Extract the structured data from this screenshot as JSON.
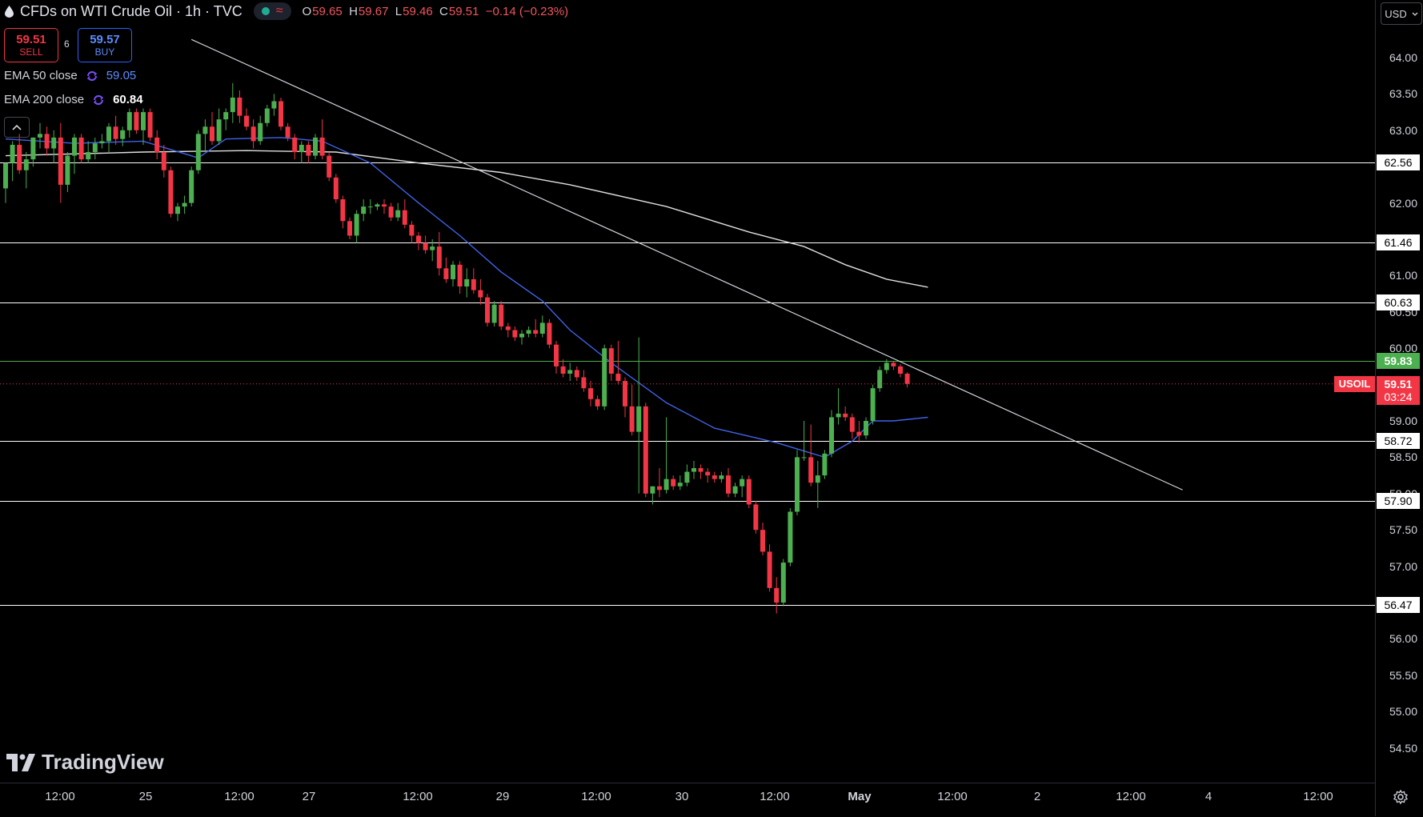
{
  "header": {
    "title": "CFDs on WTI Crude Oil · 1h · TVC",
    "ohlc": {
      "o_label": "O",
      "o": "59.65",
      "h_label": "H",
      "h": "59.67",
      "l_label": "L",
      "l": "59.46",
      "c_label": "C",
      "c": "59.51",
      "change": "−0.14 (−0.23%)"
    }
  },
  "trade": {
    "sell_price": "59.51",
    "sell_label": "SELL",
    "spread": "6",
    "buy_price": "59.57",
    "buy_label": "BUY"
  },
  "indicators": [
    {
      "label": "EMA 50 close",
      "value": "59.05",
      "color": "#5b8cff"
    },
    {
      "label": "EMA 200 close",
      "value": "60.84",
      "color": "#ffffff"
    }
  ],
  "price_axis": {
    "currency": "USD",
    "ticks": [
      "64.00",
      "63.50",
      "63.00",
      "62.00",
      "61.00",
      "60.50",
      "60.00",
      "59.00",
      "58.50",
      "58.00",
      "57.50",
      "57.00",
      "56.00",
      "55.50",
      "55.00",
      "54.50"
    ],
    "tick_values": [
      64.0,
      63.5,
      63.0,
      62.0,
      61.0,
      60.5,
      60.0,
      59.0,
      58.5,
      58.0,
      57.5,
      57.0,
      56.0,
      55.5,
      55.0,
      54.5
    ]
  },
  "levels": [
    {
      "value": 62.56,
      "label": "62.56",
      "color": "#ffffff"
    },
    {
      "value": 61.46,
      "label": "61.46",
      "color": "#ffffff"
    },
    {
      "value": 60.63,
      "label": "60.63",
      "color": "#ffffff"
    },
    {
      "value": 59.83,
      "label": "59.83",
      "color": "#4caf50"
    },
    {
      "value": 58.72,
      "label": "58.72",
      "color": "#ffffff"
    },
    {
      "value": 57.9,
      "label": "57.90",
      "color": "#ffffff"
    },
    {
      "value": 56.47,
      "label": "56.47",
      "color": "#ffffff"
    }
  ],
  "current": {
    "symbol": "USOIL",
    "price": "59.51",
    "countdown": "03:24",
    "value": 59.51
  },
  "time_axis": {
    "labels": [
      {
        "text": "12:00",
        "bold": false
      },
      {
        "text": "25",
        "bold": false
      },
      {
        "text": "12:00",
        "bold": false
      },
      {
        "text": "27",
        "bold": false
      },
      {
        "text": "12:00",
        "bold": false
      },
      {
        "text": "29",
        "bold": false
      },
      {
        "text": "12:00",
        "bold": false
      },
      {
        "text": "30",
        "bold": false
      },
      {
        "text": "12:00",
        "bold": false
      },
      {
        "text": "May",
        "bold": true
      },
      {
        "text": "12:00",
        "bold": false
      },
      {
        "text": "2",
        "bold": false
      },
      {
        "text": "12:00",
        "bold": false
      },
      {
        "text": "4",
        "bold": false
      },
      {
        "text": "12:00",
        "bold": false
      }
    ]
  },
  "branding": {
    "logo_text": "TradingView"
  },
  "colors": {
    "up": "#4caf50",
    "down": "#f23645",
    "ema50": "#3f63e8",
    "ema200": "#e0e0e0",
    "trend": "#d1d4dc"
  },
  "chart_data": {
    "type": "candlestick",
    "title": "CFDs on WTI Crude Oil · 1h · TVC",
    "ylim": [
      54.25,
      64.6
    ],
    "candles": [
      [
        62.2,
        62.55,
        62.0,
        62.55
      ],
      [
        62.55,
        62.85,
        62.3,
        62.8
      ],
      [
        62.8,
        62.95,
        62.4,
        62.45
      ],
      [
        62.45,
        62.7,
        62.2,
        62.6
      ],
      [
        62.6,
        62.9,
        62.5,
        62.9
      ],
      [
        62.9,
        63.1,
        62.75,
        62.95
      ],
      [
        62.95,
        63.05,
        62.65,
        62.75
      ],
      [
        62.75,
        63.0,
        62.55,
        62.9
      ],
      [
        62.9,
        63.1,
        62.0,
        62.25
      ],
      [
        62.25,
        62.7,
        62.15,
        62.65
      ],
      [
        62.65,
        62.95,
        62.4,
        62.9
      ],
      [
        62.9,
        62.95,
        62.55,
        62.6
      ],
      [
        62.6,
        62.85,
        62.55,
        62.7
      ],
      [
        62.7,
        62.9,
        62.6,
        62.82
      ],
      [
        62.82,
        62.95,
        62.75,
        62.85
      ],
      [
        62.85,
        63.1,
        62.7,
        63.05
      ],
      [
        63.05,
        63.2,
        62.8,
        62.88
      ],
      [
        62.88,
        63.05,
        62.78,
        63.0
      ],
      [
        63.0,
        63.3,
        62.9,
        63.25
      ],
      [
        63.25,
        63.3,
        62.95,
        63.0
      ],
      [
        63.0,
        63.3,
        62.8,
        63.25
      ],
      [
        63.25,
        63.3,
        62.85,
        62.9
      ],
      [
        62.9,
        63.0,
        62.6,
        62.7
      ],
      [
        62.7,
        62.8,
        62.35,
        62.45
      ],
      [
        62.45,
        62.5,
        61.8,
        61.85
      ],
      [
        61.85,
        62.0,
        61.75,
        61.95
      ],
      [
        61.95,
        62.1,
        61.85,
        62.0
      ],
      [
        62.0,
        62.5,
        61.95,
        62.45
      ],
      [
        62.45,
        63.0,
        62.4,
        62.95
      ],
      [
        62.95,
        63.15,
        62.7,
        63.05
      ],
      [
        63.05,
        63.25,
        62.8,
        62.85
      ],
      [
        62.85,
        63.3,
        62.8,
        63.15
      ],
      [
        63.15,
        63.3,
        63.0,
        63.25
      ],
      [
        63.25,
        63.65,
        63.1,
        63.45
      ],
      [
        63.45,
        63.55,
        63.1,
        63.2
      ],
      [
        63.2,
        63.3,
        63.0,
        63.05
      ],
      [
        63.05,
        63.15,
        62.75,
        62.85
      ],
      [
        62.85,
        63.2,
        62.8,
        63.1
      ],
      [
        63.1,
        63.35,
        63.05,
        63.3
      ],
      [
        63.3,
        63.5,
        63.2,
        63.4
      ],
      [
        63.4,
        63.45,
        63.0,
        63.05
      ],
      [
        63.05,
        63.1,
        62.85,
        62.9
      ],
      [
        62.9,
        62.95,
        62.6,
        62.7
      ],
      [
        62.7,
        62.85,
        62.55,
        62.8
      ],
      [
        62.8,
        62.85,
        62.55,
        62.65
      ],
      [
        62.65,
        62.95,
        62.6,
        62.9
      ],
      [
        62.9,
        63.15,
        62.6,
        62.65
      ],
      [
        62.65,
        62.7,
        62.3,
        62.35
      ],
      [
        62.35,
        62.4,
        62.0,
        62.05
      ],
      [
        62.05,
        62.1,
        61.65,
        61.75
      ],
      [
        61.75,
        61.8,
        61.5,
        61.55
      ],
      [
        61.55,
        61.9,
        61.45,
        61.85
      ],
      [
        61.85,
        62.05,
        61.75,
        61.95
      ],
      [
        61.95,
        62.05,
        61.85,
        61.95
      ],
      [
        61.95,
        62.0,
        61.9,
        61.98
      ],
      [
        61.98,
        62.05,
        61.85,
        61.95
      ],
      [
        61.95,
        62.0,
        61.75,
        61.8
      ],
      [
        61.8,
        62.0,
        61.75,
        61.9
      ],
      [
        61.9,
        62.05,
        61.65,
        61.7
      ],
      [
        61.7,
        61.75,
        61.45,
        61.55
      ],
      [
        61.55,
        61.6,
        61.35,
        61.45
      ],
      [
        61.45,
        61.55,
        61.3,
        61.35
      ],
      [
        61.35,
        61.5,
        61.2,
        61.4
      ],
      [
        61.4,
        61.6,
        61.0,
        61.1
      ],
      [
        61.1,
        61.25,
        60.9,
        60.95
      ],
      [
        60.95,
        61.2,
        60.85,
        61.15
      ],
      [
        61.15,
        61.2,
        60.75,
        60.85
      ],
      [
        60.85,
        61.1,
        60.7,
        60.95
      ],
      [
        60.95,
        61.1,
        60.75,
        60.8
      ],
      [
        60.8,
        60.95,
        60.6,
        60.7
      ],
      [
        60.7,
        60.75,
        60.3,
        60.35
      ],
      [
        60.35,
        60.65,
        60.3,
        60.6
      ],
      [
        60.6,
        60.65,
        60.25,
        60.3
      ],
      [
        60.3,
        60.35,
        60.15,
        60.25
      ],
      [
        60.25,
        60.3,
        60.1,
        60.15
      ],
      [
        60.15,
        60.25,
        60.05,
        60.2
      ],
      [
        60.2,
        60.3,
        60.15,
        60.25
      ],
      [
        60.25,
        60.4,
        60.15,
        60.2
      ],
      [
        60.2,
        60.45,
        60.15,
        60.35
      ],
      [
        60.35,
        60.4,
        60.0,
        60.05
      ],
      [
        60.05,
        60.1,
        59.65,
        59.75
      ],
      [
        59.75,
        59.85,
        59.6,
        59.65
      ],
      [
        59.65,
        59.8,
        59.55,
        59.7
      ],
      [
        59.7,
        59.75,
        59.55,
        59.6
      ],
      [
        59.6,
        59.7,
        59.4,
        59.45
      ],
      [
        59.45,
        59.55,
        59.2,
        59.3
      ],
      [
        59.3,
        59.35,
        59.15,
        59.2
      ],
      [
        59.2,
        60.05,
        59.15,
        60.0
      ],
      [
        60.0,
        60.05,
        59.55,
        59.65
      ],
      [
        59.65,
        60.1,
        59.5,
        59.55
      ],
      [
        59.55,
        59.6,
        59.05,
        59.2
      ],
      [
        59.2,
        59.5,
        58.8,
        58.85
      ],
      [
        58.85,
        60.15,
        58.0,
        59.2
      ],
      [
        59.2,
        59.25,
        57.95,
        58.0
      ],
      [
        58.0,
        58.1,
        57.85,
        58.1
      ],
      [
        58.1,
        58.35,
        57.95,
        58.05
      ],
      [
        58.05,
        59.05,
        58.0,
        58.2
      ],
      [
        58.2,
        58.25,
        58.05,
        58.1
      ],
      [
        58.1,
        58.25,
        58.05,
        58.15
      ],
      [
        58.15,
        58.4,
        58.1,
        58.3
      ],
      [
        58.3,
        58.45,
        58.2,
        58.35
      ],
      [
        58.35,
        58.4,
        58.2,
        58.3
      ],
      [
        58.3,
        58.35,
        58.15,
        58.25
      ],
      [
        58.25,
        58.3,
        58.15,
        58.2
      ],
      [
        58.2,
        58.3,
        58.15,
        58.25
      ],
      [
        58.25,
        58.35,
        57.95,
        58.0
      ],
      [
        58.0,
        58.15,
        57.95,
        58.1
      ],
      [
        58.1,
        58.25,
        57.95,
        58.2
      ],
      [
        58.2,
        58.25,
        57.8,
        57.85
      ],
      [
        57.85,
        57.9,
        57.45,
        57.5
      ],
      [
        57.5,
        57.6,
        57.15,
        57.2
      ],
      [
        57.2,
        57.3,
        56.65,
        56.7
      ],
      [
        56.7,
        56.85,
        56.35,
        56.5
      ],
      [
        56.5,
        57.1,
        56.45,
        57.05
      ],
      [
        57.05,
        57.8,
        57.0,
        57.75
      ],
      [
        57.75,
        58.6,
        57.7,
        58.5
      ],
      [
        58.5,
        59.0,
        58.45,
        58.5
      ],
      [
        58.5,
        58.95,
        58.1,
        58.15
      ],
      [
        58.15,
        58.45,
        57.8,
        58.25
      ],
      [
        58.25,
        58.6,
        58.2,
        58.55
      ],
      [
        58.55,
        59.15,
        58.5,
        59.05
      ],
      [
        59.05,
        59.45,
        58.95,
        59.1
      ],
      [
        59.1,
        59.2,
        59.0,
        59.05
      ],
      [
        59.05,
        59.1,
        58.75,
        58.85
      ],
      [
        58.85,
        59.0,
        58.7,
        58.8
      ],
      [
        58.8,
        59.05,
        58.75,
        59.0
      ],
      [
        59.0,
        59.5,
        58.95,
        59.45
      ],
      [
        59.45,
        59.75,
        59.4,
        59.7
      ],
      [
        59.7,
        59.85,
        59.65,
        59.8
      ],
      [
        59.8,
        59.82,
        59.7,
        59.75
      ],
      [
        59.75,
        59.78,
        59.6,
        59.65
      ],
      [
        59.65,
        59.67,
        59.46,
        59.51
      ]
    ],
    "ema50": [
      [
        0,
        62.88
      ],
      [
        10,
        62.82
      ],
      [
        20,
        62.85
      ],
      [
        28,
        62.62
      ],
      [
        32,
        62.88
      ],
      [
        40,
        62.9
      ],
      [
        46,
        62.85
      ],
      [
        53,
        62.55
      ],
      [
        60,
        62.0
      ],
      [
        66,
        61.55
      ],
      [
        72,
        61.05
      ],
      [
        78,
        60.65
      ],
      [
        82,
        60.25
      ],
      [
        88,
        59.8
      ],
      [
        96,
        59.25
      ],
      [
        103,
        58.9
      ],
      [
        112,
        58.7
      ],
      [
        119,
        58.5
      ],
      [
        123,
        58.72
      ],
      [
        126,
        59.0
      ],
      [
        129,
        59.0
      ],
      [
        134,
        59.05
      ]
    ],
    "ema200": [
      [
        0,
        62.65
      ],
      [
        20,
        62.7
      ],
      [
        35,
        62.72
      ],
      [
        48,
        62.7
      ],
      [
        60,
        62.55
      ],
      [
        72,
        62.42
      ],
      [
        82,
        62.25
      ],
      [
        96,
        61.95
      ],
      [
        108,
        61.6
      ],
      [
        116,
        61.4
      ],
      [
        122,
        61.15
      ],
      [
        128,
        60.95
      ],
      [
        134,
        60.84
      ]
    ],
    "trendline": [
      [
        27,
        64.25
      ],
      [
        171,
        58.05
      ]
    ],
    "x_extent": [
      -0.5,
      171
    ]
  }
}
